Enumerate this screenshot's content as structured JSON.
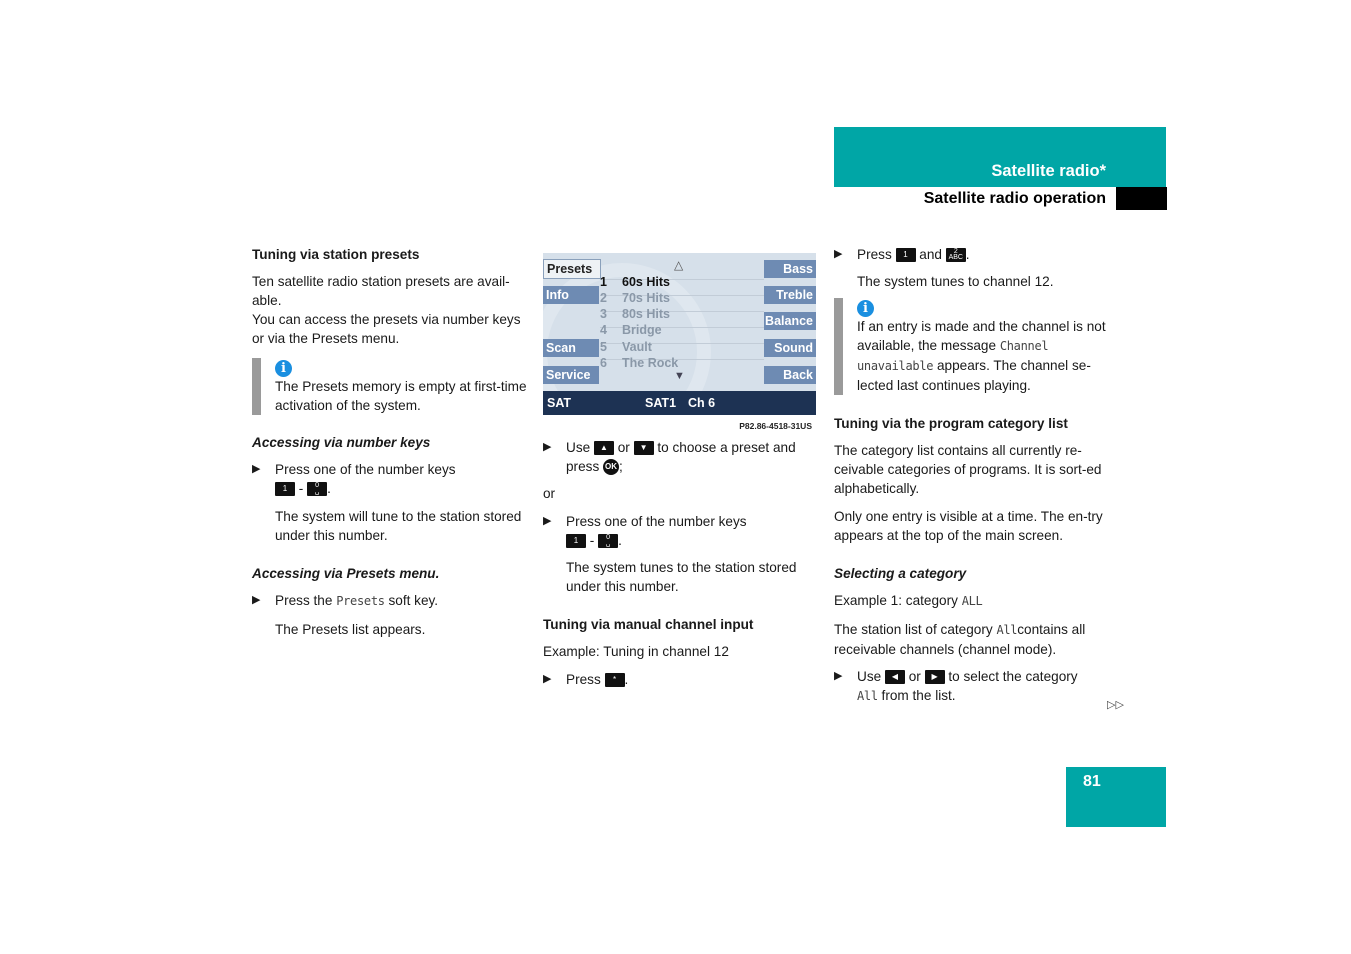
{
  "header": {
    "section_title": "Satellite radio*",
    "subsection_title": "Satellite radio operation",
    "page_number": "81",
    "accent_color": "#00a6a6"
  },
  "col1": {
    "heading": "Tuning via station presets",
    "intro_1": "Ten satellite radio station presets are avail-able.",
    "intro_2": "You can access the presets via number keys or via the Presets menu.",
    "info_icon": "info-icon",
    "info_text": "The Presets memory is empty at first-time activation of the system.",
    "sub1_heading": "Accessing via number keys",
    "sub1_step": "Press one of the number keys",
    "key_first": "1",
    "key_sep": "-",
    "key_last_top": "0",
    "key_last_bottom": "␣",
    "sub1_result": "The system will tune to the station stored under this number.",
    "sub2_heading": "Accessing via Presets menu.",
    "sub2_step_pre": "Press the ",
    "sub2_step_mono": "Presets",
    "sub2_step_post": " soft key.",
    "sub2_result": "The Presets list appears."
  },
  "screen": {
    "left_keys": [
      "Presets",
      "Info",
      "Scan",
      "Service"
    ],
    "right_keys": [
      "Bass",
      "Treble",
      "Balance",
      "Sound",
      "Back"
    ],
    "scroll_up": "△",
    "scroll_down": "▼",
    "presets": [
      {
        "num": "1",
        "name": "60s Hits"
      },
      {
        "num": "2",
        "name": "70s Hits"
      },
      {
        "num": "3",
        "name": "80s Hits"
      },
      {
        "num": "4",
        "name": "Bridge"
      },
      {
        "num": "5",
        "name": "Vault"
      },
      {
        "num": "6",
        "name": "The Rock"
      }
    ],
    "status_left": "SAT",
    "status_band": "SAT1",
    "status_channel": "Ch 6",
    "caption": "P82.86-4518-31US"
  },
  "col2": {
    "step1_pre": "Use ",
    "step1_mid": " or ",
    "step1_post": " to choose a preset and press ",
    "step1_end": ";",
    "up_key": "▲",
    "down_key": "▼",
    "ok_key": "OK",
    "or_text": "or",
    "step2": "Press one of the number keys",
    "step2_result": "The system tunes to the station stored under this number.",
    "heading": "Tuning via manual channel input",
    "example": "Example: Tuning in channel 12",
    "step3_pre": "Press ",
    "star_key": "*",
    "step3_post": "."
  },
  "col3": {
    "step1_pre": "Press ",
    "key1": "1",
    "step1_mid": " and ",
    "key2_top": "2",
    "key2_bottom": "ABC",
    "step1_post": ".",
    "step1_result": "The system tunes to channel 12.",
    "info_pre": "If an entry is made and the channel is not available, the message ",
    "info_mono": "Channel unavailable",
    "info_post": " appears. The channel se-lected last continues playing.",
    "heading": "Tuning via the program category list",
    "para1": "The category list contains all currently re-ceivable categories of programs. It is sort-ed alphabetically.",
    "para2": "Only one entry is visible at a time. The en-try appears at the top of the main screen.",
    "sub_heading": "Selecting a category",
    "example_pre": "Example 1: category ",
    "example_mono": "ALL",
    "para3_pre": "The station list of category ",
    "para3_mono": "All",
    "para3_post": "contains all receivable channels (channel mode).",
    "step2_pre": "Use ",
    "left_key": "◀",
    "step2_mid": " or ",
    "right_key": "▶",
    "step2_post": " to select the category",
    "step2_mono": "All",
    "step2_end": " from the list.",
    "continue_marker": "▷▷"
  }
}
